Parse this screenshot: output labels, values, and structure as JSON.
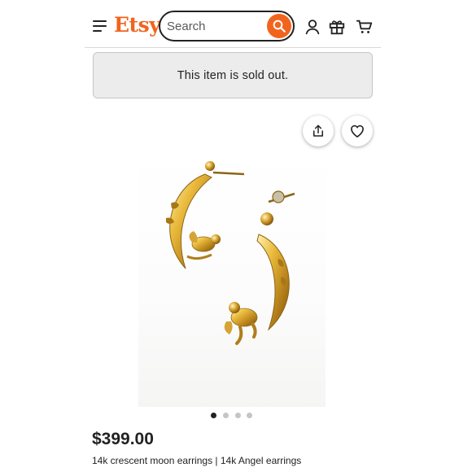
{
  "header": {
    "logo_text": "Etsy",
    "brand_color": "#F1641E",
    "search": {
      "placeholder": "Search",
      "value": ""
    },
    "icons": [
      "menu-icon",
      "search-icon",
      "account-icon",
      "gift-icon",
      "cart-icon"
    ]
  },
  "notice": {
    "text": "This item is sold out."
  },
  "image_actions": {
    "icons": [
      "share-icon",
      "heart-icon"
    ]
  },
  "carousel": {
    "total": 4,
    "active_index": 0
  },
  "listing": {
    "price": "$399.00",
    "title": "14k crescent moon earrings | 14k Angel earrings"
  }
}
